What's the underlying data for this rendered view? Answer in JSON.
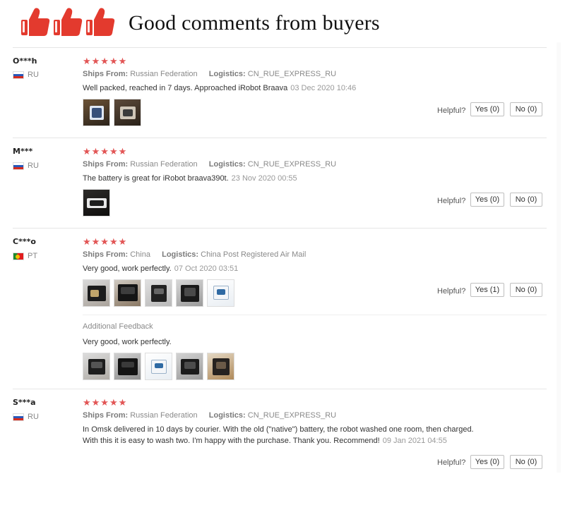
{
  "header": {
    "title": "Good comments from buyers",
    "colors": {
      "thumb": "#e33a2e",
      "title": "#111111"
    },
    "thumb_icons": [
      "thumbs-up-icon",
      "thumbs-up-icon",
      "thumbs-up-icon"
    ]
  },
  "labels": {
    "ships_from": "Ships From:",
    "logistics": "Logistics:",
    "helpful": "Helpful?",
    "additional_feedback": "Additional Feedback"
  },
  "reviews": [
    {
      "user": "O***h",
      "country": "RU",
      "stars": "★★★★★",
      "ships_from": "Russian Federation",
      "logistics": "CN_RUE_EXPRESS_RU",
      "text": "Well packed, reached in 7 days. Approached iRobot Braava",
      "date": "03 Dec 2020 10:46",
      "yes": "Yes (0)",
      "no": "No (0)"
    },
    {
      "user": "M***",
      "country": "RU",
      "stars": "★★★★★",
      "ships_from": "Russian Federation",
      "logistics": "CN_RUE_EXPRESS_RU",
      "text": "The battery is great for iRobot braava390t.",
      "date": "23 Nov 2020 00:55",
      "yes": "Yes (0)",
      "no": "No (0)"
    },
    {
      "user": "C***o",
      "country": "PT",
      "stars": "★★★★★",
      "ships_from": "China",
      "logistics": "China Post Registered Air Mail",
      "text": "Very good, work perfectly.",
      "date": "07 Oct 2020 03:51",
      "yes": "Yes (1)",
      "no": "No (0)",
      "additional_text": "Very good, work perfectly."
    },
    {
      "user": "S***a",
      "country": "RU",
      "stars": "★★★★★",
      "ships_from": "Russian Federation",
      "logistics": "CN_RUE_EXPRESS_RU",
      "text_line1": "In Omsk delivered in 10 days by courier. With the old (\"native\") battery, the robot washed one room, then charged.",
      "text_line2": "With this it is easy to wash two. I'm happy with the purchase. Thank you. Recommend!",
      "date": "09 Jan 2021 04:55",
      "yes": "Yes (0)",
      "no": "No (0)"
    }
  ],
  "colors": {
    "stars": "#e25555",
    "muted": "#8a8a8a",
    "date": "#999999"
  }
}
